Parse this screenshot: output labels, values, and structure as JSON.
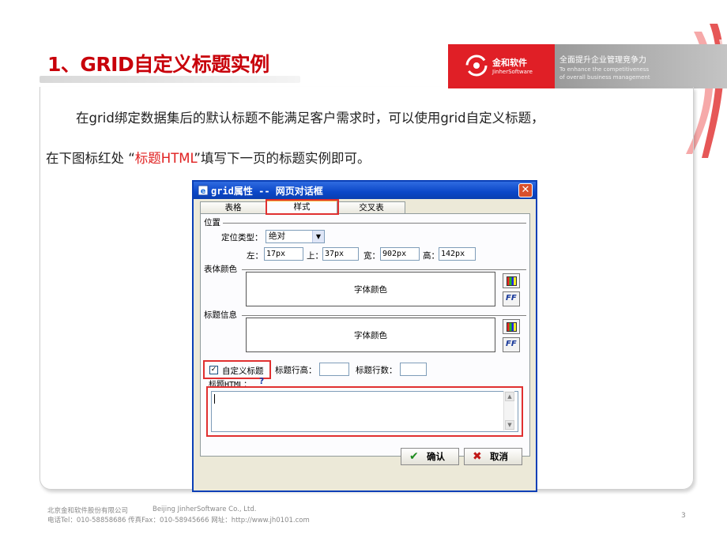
{
  "slide": {
    "title": "1、GRID自定义标题实例",
    "paragraph_line1": "在grid绑定数据集后的默认标题不能满足客户需求时，可以使用grid自定义标题，",
    "paragraph_line2_before": "在下图标红处 “",
    "paragraph_line2_highlight": "标题HTML",
    "paragraph_line2_after": "”填写下一页的标题实例即可。",
    "page_number": "3"
  },
  "brand": {
    "logo_cn": "金和软件",
    "logo_en": "JinherSoftware",
    "slogan_cn": "全面提升企业管理竞争力",
    "slogan_en_line1": "To enhance the competitiveness",
    "slogan_en_line2": "of overall business management",
    "accent_color": "#e01f26"
  },
  "dialog": {
    "title": "grid属性 -- 网页对话框",
    "close_label": "✕",
    "tabs": [
      {
        "label": "表格",
        "selected": false
      },
      {
        "label": "样式",
        "selected": true
      },
      {
        "label": "交叉表",
        "selected": false
      }
    ],
    "position_section": "位置",
    "position_type_label": "定位类型：",
    "position_type_value": "绝对",
    "left_label": "左：",
    "left_value": "17px",
    "top_label": "上：",
    "top_value": "37px",
    "width_label": "宽：",
    "width_value": "902px",
    "height_label": "高：",
    "height_value": "142px",
    "body_color_section": "表体颜色",
    "body_font_color": "字体颜色",
    "title_info_section": "标题信息",
    "title_font_color": "字体颜色",
    "custom_title_label": "自定义标题",
    "custom_title_checked": true,
    "title_row_height_label": "标题行高：",
    "title_row_height_value": "",
    "title_row_count_label": "标题行数：",
    "title_row_count_value": "",
    "title_html_label": "标题HTML：",
    "help_label": "?",
    "title_html_value": "",
    "ok_label": "确认",
    "cancel_label": "取消"
  },
  "footer": {
    "company_cn": "北京金和软件股份有限公司",
    "company_en": "Beijing JinherSoftware Co., Ltd.",
    "contact": "电话Tel：010-58858686    传真Fax：010-58945666    网址：http://www.jh0101.com"
  }
}
